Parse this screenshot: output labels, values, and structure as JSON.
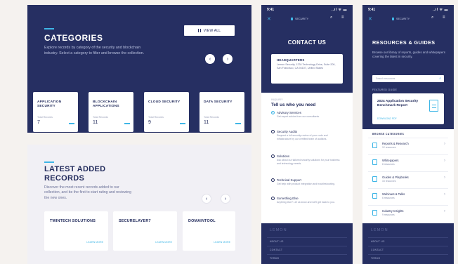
{
  "categories": {
    "title": "CATEGORIES",
    "subtitle": "Explore records by category of the security and blockchain industry. Select a category to filter and browse the collection.",
    "view_all_label": "VIEW ALL",
    "prev_symbol": "‹",
    "next_symbol": "›",
    "count_label": "Total Records",
    "cards": [
      {
        "name": "APPLICATION SECURITY",
        "count": "7"
      },
      {
        "name": "BLOCKCHAIN APPLICATIONS",
        "count": "11"
      },
      {
        "name": "CLOUD SECURITY",
        "count": "9"
      },
      {
        "name": "DATA SECURITY",
        "count": "11"
      }
    ]
  },
  "latest": {
    "title": "LATEST ADDED RECORDS",
    "subtitle": "Discover the most recent records added to our collection, and be the first to start rating and reviewing the new ones.",
    "prev_symbol": "‹",
    "next_symbol": "›",
    "more_label": "LEARN MORE",
    "cards": [
      {
        "name": "TWINTECH SOLUTIONS"
      },
      {
        "name": "SECURELAYER7"
      },
      {
        "name": "DOMAINTOOL"
      }
    ]
  },
  "phone_common": {
    "time": "9:41",
    "signal": "..ıl ᯤ ▬",
    "close_symbol": "✕",
    "logo": "SECURITY",
    "search_symbol": "⌕",
    "menu_symbol": "≡",
    "footer_logo": "LEMON",
    "footer_links": [
      "ABOUT US",
      "CONTACT",
      "TERMS"
    ]
  },
  "contact": {
    "title": "CONTACT US",
    "hq_title": "HEADQUARTERS",
    "hq_address": "Lemon Security, 1234 Technology Drive, Suite 200, San Francisco, CA 94107, United States",
    "form_caption": "INQUIRY",
    "form_title": "Tell us who you need",
    "options": [
      {
        "title": "Advisory Services",
        "desc": "Get expert advice from our consultants.",
        "selected": true
      },
      {
        "title": "Security Audits",
        "desc": "Request a full security review of your code and infrastructure by our certified team of auditors.",
        "selected": false
      },
      {
        "title": "Solutions",
        "desc": "Ask about our tailored security solutions for your business and technology needs.",
        "selected": false
      },
      {
        "title": "Technical Support",
        "desc": "Get help with product integration and troubleshooting.",
        "selected": false
      },
      {
        "title": "Something Else",
        "desc": "Anything else? Let us know and we'll get back to you.",
        "selected": false
      }
    ]
  },
  "resources": {
    "title": "RESOURCES & GUIDES",
    "subtitle": "Browse our library of reports, guides and whitepapers covering the latest in security.",
    "search_placeholder": "Search resources",
    "featured_caption": "FEATURED GUIDE",
    "featured_title": "2024 Application Security Benchmark Report",
    "featured_cta": "DOWNLOAD PDF",
    "browse_caption": "BROWSE CATEGORIES",
    "items": [
      {
        "name": "Reports & Research",
        "count": "12 resources"
      },
      {
        "name": "Whitepapers",
        "count": "8 resources"
      },
      {
        "name": "Guides & Playbooks",
        "count": "15 resources"
      },
      {
        "name": "Webinars & Talks",
        "count": "6 resources"
      },
      {
        "name": "Industry Insights",
        "count": "9 resources"
      }
    ],
    "chevron": "›"
  }
}
